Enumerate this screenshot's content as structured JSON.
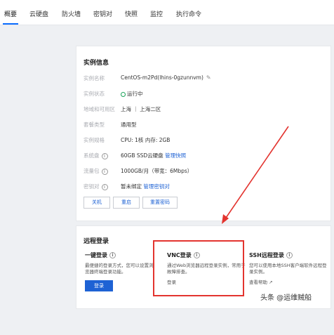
{
  "tabs": [
    "概要",
    "云硬盘",
    "防火墙",
    "密钥对",
    "快照",
    "监控",
    "执行命令"
  ],
  "instance_card": {
    "title": "实例信息",
    "rows": [
      {
        "label": "实例名称",
        "value": "CentOS-m2Pd(lhins-0gzunnvm)"
      },
      {
        "label": "实例状态",
        "value": "运行中"
      },
      {
        "label": "地域和可用区",
        "value": "上海 ｜ 上海二区"
      },
      {
        "label": "套餐类型",
        "value": "通用型"
      },
      {
        "label": "实例规格",
        "value": "CPU: 1核 内存: 2GB"
      },
      {
        "label": "系统盘",
        "value": "60GB SSD云硬盘",
        "link": "管理快照"
      },
      {
        "label": "流量包",
        "value": "1000GB/月（带宽：6Mbps）"
      },
      {
        "label": "密钥对",
        "value": "暂未绑定",
        "link": "管理密钥对"
      }
    ],
    "buttons": [
      "关机",
      "重启",
      "重置密码"
    ]
  },
  "remote_card": {
    "title": "远程登录",
    "one_click": {
      "title": "一键登录",
      "desc": "最便捷的登录方式，您可以设置浏览器终端登录功能。",
      "button": "登录"
    },
    "vnc": {
      "title": "VNC登录",
      "desc": "通过Web浏览器远程登录实例，常用于故障排查。",
      "link": "登录"
    },
    "ssh": {
      "title": "SSH远程登录",
      "desc": "您可以使用本地SSH客户端软件远程登录实例。",
      "link": "查看帮助"
    }
  },
  "watermark": "头条 @运维贼船",
  "colors": {
    "accent": "#1e62d4",
    "highlight": "#e3342f",
    "status_ok": "#1aa35a"
  }
}
